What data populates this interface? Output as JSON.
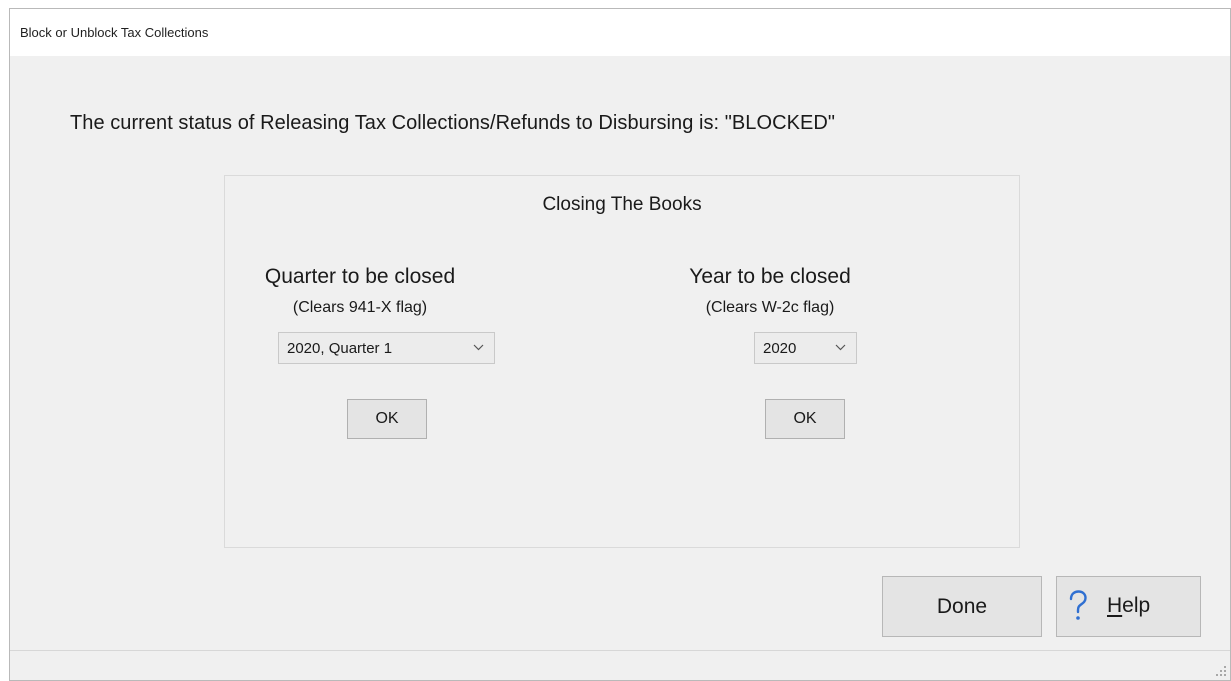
{
  "window": {
    "title": "Block or Unblock Tax Collections"
  },
  "status": {
    "text": "The current status of Releasing Tax Collections/Refunds to Disbursing is: \"BLOCKED\""
  },
  "closing_books": {
    "title": "Closing The Books",
    "quarter": {
      "label": "Quarter to be closed",
      "sublabel": "(Clears 941-X flag)",
      "selected": "2020, Quarter 1",
      "ok_label": "OK"
    },
    "year": {
      "label": "Year to be closed",
      "sublabel": "(Clears W-2c flag)",
      "selected": "2020",
      "ok_label": "OK"
    }
  },
  "buttons": {
    "done_label": "Done",
    "help_mnemonic": "H",
    "help_rest": "elp"
  },
  "icons": {
    "help": "question-mark-icon",
    "dropdown": "chevron-down-icon",
    "resize": "resize-grip-icon"
  },
  "colors": {
    "help_icon": "#2f6fd1",
    "window_bg": "#f0f0f0",
    "button_bg": "#e4e4e4"
  }
}
